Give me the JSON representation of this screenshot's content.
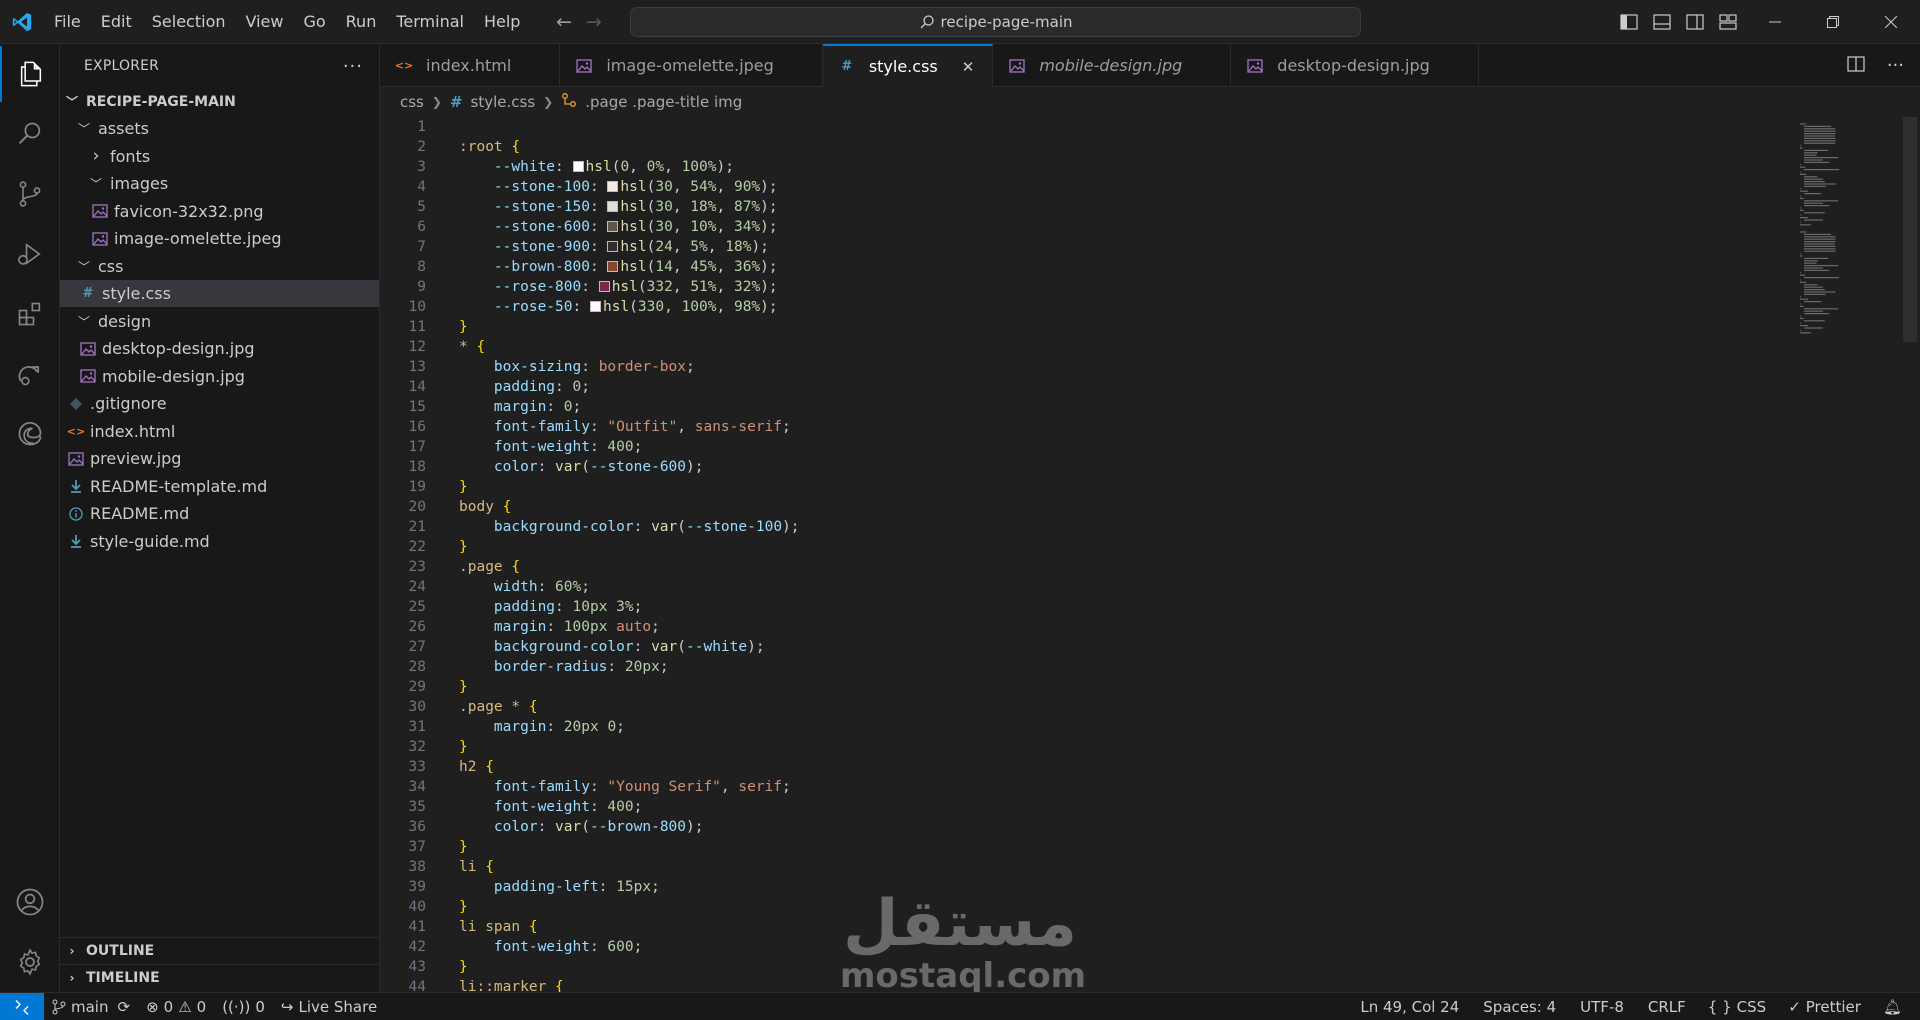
{
  "titlebar": {
    "menu": [
      "File",
      "Edit",
      "Selection",
      "View",
      "Go",
      "Run",
      "Terminal",
      "Help"
    ],
    "search": "recipe-page-main"
  },
  "sidebar": {
    "title": "EXPLORER",
    "root": "RECIPE-PAGE-MAIN",
    "tree": [
      {
        "label": "assets",
        "depth": 1,
        "kind": "folder-open"
      },
      {
        "label": "fonts",
        "depth": 2,
        "kind": "folder-closed"
      },
      {
        "label": "images",
        "depth": 2,
        "kind": "folder-open"
      },
      {
        "label": "favicon-32x32.png",
        "depth": 3,
        "kind": "image"
      },
      {
        "label": "image-omelette.jpeg",
        "depth": 3,
        "kind": "image"
      },
      {
        "label": "css",
        "depth": 1,
        "kind": "folder-open"
      },
      {
        "label": "style.css",
        "depth": 2,
        "kind": "css",
        "selected": true
      },
      {
        "label": "design",
        "depth": 1,
        "kind": "folder-open"
      },
      {
        "label": "desktop-design.jpg",
        "depth": 2,
        "kind": "image"
      },
      {
        "label": "mobile-design.jpg",
        "depth": 2,
        "kind": "image"
      },
      {
        "label": ".gitignore",
        "depth": 1,
        "kind": "git"
      },
      {
        "label": "index.html",
        "depth": 1,
        "kind": "html"
      },
      {
        "label": "preview.jpg",
        "depth": 1,
        "kind": "image"
      },
      {
        "label": "README-template.md",
        "depth": 1,
        "kind": "md"
      },
      {
        "label": "README.md",
        "depth": 1,
        "kind": "info"
      },
      {
        "label": "style-guide.md",
        "depth": 1,
        "kind": "md"
      }
    ],
    "outline": "OUTLINE",
    "timeline": "TIMELINE"
  },
  "tabs": [
    {
      "label": "index.html",
      "kind": "html",
      "active": false,
      "preview": false
    },
    {
      "label": "image-omelette.jpeg",
      "kind": "image",
      "active": false,
      "preview": false
    },
    {
      "label": "style.css",
      "kind": "css",
      "active": true,
      "preview": false
    },
    {
      "label": "mobile-design.jpg",
      "kind": "image",
      "active": false,
      "preview": true
    },
    {
      "label": "desktop-design.jpg",
      "kind": "image",
      "active": false,
      "preview": false
    }
  ],
  "breadcrumb": {
    "folder": "css",
    "file": "style.css",
    "symbol": ".page .page-title img"
  },
  "code": [
    [],
    [
      [
        "s-sel",
        ":root"
      ],
      [
        "s-pun",
        " "
      ],
      [
        "s-br",
        "{"
      ]
    ],
    [
      [
        "s-pun",
        "    "
      ],
      [
        "s-prop",
        "--white"
      ],
      [
        "s-pun",
        ": "
      ],
      [
        "sw",
        "#ffffff"
      ],
      [
        "s-fn",
        "hsl"
      ],
      [
        "s-pun",
        "("
      ],
      [
        "s-num",
        "0"
      ],
      [
        "s-pun",
        ", "
      ],
      [
        "s-num",
        "0%"
      ],
      [
        "s-pun",
        ", "
      ],
      [
        "s-num",
        "100%"
      ],
      [
        "s-pun",
        ");"
      ]
    ],
    [
      [
        "s-pun",
        "    "
      ],
      [
        "s-prop",
        "--stone-100"
      ],
      [
        "s-pun",
        ": "
      ],
      [
        "sw",
        "#f2e9e1"
      ],
      [
        "s-fn",
        "hsl"
      ],
      [
        "s-pun",
        "("
      ],
      [
        "s-num",
        "30"
      ],
      [
        "s-pun",
        ", "
      ],
      [
        "s-num",
        "54%"
      ],
      [
        "s-pun",
        ", "
      ],
      [
        "s-num",
        "90%"
      ],
      [
        "s-pun",
        ");"
      ]
    ],
    [
      [
        "s-pun",
        "    "
      ],
      [
        "s-prop",
        "--stone-150"
      ],
      [
        "s-pun",
        ": "
      ],
      [
        "sw",
        "#e3ddd7"
      ],
      [
        "s-fn",
        "hsl"
      ],
      [
        "s-pun",
        "("
      ],
      [
        "s-num",
        "30"
      ],
      [
        "s-pun",
        ", "
      ],
      [
        "s-num",
        "18%"
      ],
      [
        "s-pun",
        ", "
      ],
      [
        "s-num",
        "87%"
      ],
      [
        "s-pun",
        ");"
      ]
    ],
    [
      [
        "s-pun",
        "    "
      ],
      [
        "s-prop",
        "--stone-600"
      ],
      [
        "s-pun",
        ": "
      ],
      [
        "sw",
        "#5f564d"
      ],
      [
        "s-fn",
        "hsl"
      ],
      [
        "s-pun",
        "("
      ],
      [
        "s-num",
        "30"
      ],
      [
        "s-pun",
        ", "
      ],
      [
        "s-num",
        "10%"
      ],
      [
        "s-pun",
        ", "
      ],
      [
        "s-num",
        "34%"
      ],
      [
        "s-pun",
        ");"
      ]
    ],
    [
      [
        "s-pun",
        "    "
      ],
      [
        "s-prop",
        "--stone-900"
      ],
      [
        "s-pun",
        ": "
      ],
      [
        "sw",
        "#312e2c"
      ],
      [
        "s-fn",
        "hsl"
      ],
      [
        "s-pun",
        "("
      ],
      [
        "s-num",
        "24"
      ],
      [
        "s-pun",
        ", "
      ],
      [
        "s-num",
        "5%"
      ],
      [
        "s-pun",
        ", "
      ],
      [
        "s-num",
        "18%"
      ],
      [
        "s-pun",
        ");"
      ]
    ],
    [
      [
        "s-pun",
        "    "
      ],
      [
        "s-prop",
        "--brown-800"
      ],
      [
        "s-pun",
        ": "
      ],
      [
        "sw",
        "#854632"
      ],
      [
        "s-fn",
        "hsl"
      ],
      [
        "s-pun",
        "("
      ],
      [
        "s-num",
        "14"
      ],
      [
        "s-pun",
        ", "
      ],
      [
        "s-num",
        "45%"
      ],
      [
        "s-pun",
        ", "
      ],
      [
        "s-num",
        "36%"
      ],
      [
        "s-pun",
        ");"
      ]
    ],
    [
      [
        "s-pun",
        "    "
      ],
      [
        "s-prop",
        "--rose-800"
      ],
      [
        "s-pun",
        ": "
      ],
      [
        "sw",
        "#7a284e"
      ],
      [
        "s-fn",
        "hsl"
      ],
      [
        "s-pun",
        "("
      ],
      [
        "s-num",
        "332"
      ],
      [
        "s-pun",
        ", "
      ],
      [
        "s-num",
        "51%"
      ],
      [
        "s-pun",
        ", "
      ],
      [
        "s-num",
        "32%"
      ],
      [
        "s-pun",
        ");"
      ]
    ],
    [
      [
        "s-pun",
        "    "
      ],
      [
        "s-prop",
        "--rose-50"
      ],
      [
        "s-pun",
        ": "
      ],
      [
        "sw",
        "#fff7fb"
      ],
      [
        "s-fn",
        "hsl"
      ],
      [
        "s-pun",
        "("
      ],
      [
        "s-num",
        "330"
      ],
      [
        "s-pun",
        ", "
      ],
      [
        "s-num",
        "100%"
      ],
      [
        "s-pun",
        ", "
      ],
      [
        "s-num",
        "98%"
      ],
      [
        "s-pun",
        ");"
      ]
    ],
    [
      [
        "s-br",
        "}"
      ]
    ],
    [
      [
        "s-sel",
        "*"
      ],
      [
        "s-pun",
        " "
      ],
      [
        "s-br",
        "{"
      ]
    ],
    [
      [
        "s-pun",
        "    "
      ],
      [
        "s-prop",
        "box-sizing"
      ],
      [
        "s-pun",
        ": "
      ],
      [
        "s-val",
        "border-box"
      ],
      [
        "s-pun",
        ";"
      ]
    ],
    [
      [
        "s-pun",
        "    "
      ],
      [
        "s-prop",
        "padding"
      ],
      [
        "s-pun",
        ": "
      ],
      [
        "s-num",
        "0"
      ],
      [
        "s-pun",
        ";"
      ]
    ],
    [
      [
        "s-pun",
        "    "
      ],
      [
        "s-prop",
        "margin"
      ],
      [
        "s-pun",
        ": "
      ],
      [
        "s-num",
        "0"
      ],
      [
        "s-pun",
        ";"
      ]
    ],
    [
      [
        "s-pun",
        "    "
      ],
      [
        "s-prop",
        "font-family"
      ],
      [
        "s-pun",
        ": "
      ],
      [
        "s-val",
        "\"Outfit\""
      ],
      [
        "s-pun",
        ", "
      ],
      [
        "s-val",
        "sans-serif"
      ],
      [
        "s-pun",
        ";"
      ]
    ],
    [
      [
        "s-pun",
        "    "
      ],
      [
        "s-prop",
        "font-weight"
      ],
      [
        "s-pun",
        ": "
      ],
      [
        "s-num",
        "400"
      ],
      [
        "s-pun",
        ";"
      ]
    ],
    [
      [
        "s-pun",
        "    "
      ],
      [
        "s-prop",
        "color"
      ],
      [
        "s-pun",
        ": "
      ],
      [
        "s-fn",
        "var"
      ],
      [
        "s-pun",
        "("
      ],
      [
        "s-prop",
        "--stone-600"
      ],
      [
        "s-pun",
        ");"
      ]
    ],
    [
      [
        "s-br",
        "}"
      ]
    ],
    [
      [
        "s-sel",
        "body"
      ],
      [
        "s-pun",
        " "
      ],
      [
        "s-br",
        "{"
      ]
    ],
    [
      [
        "s-pun",
        "    "
      ],
      [
        "s-prop",
        "background-color"
      ],
      [
        "s-pun",
        ": "
      ],
      [
        "s-fn",
        "var"
      ],
      [
        "s-pun",
        "("
      ],
      [
        "s-prop",
        "--stone-100"
      ],
      [
        "s-pun",
        ");"
      ]
    ],
    [
      [
        "s-br",
        "}"
      ]
    ],
    [
      [
        "s-sel",
        ".page"
      ],
      [
        "s-pun",
        " "
      ],
      [
        "s-br",
        "{"
      ]
    ],
    [
      [
        "s-pun",
        "    "
      ],
      [
        "s-prop",
        "width"
      ],
      [
        "s-pun",
        ": "
      ],
      [
        "s-num",
        "60%"
      ],
      [
        "s-pun",
        ";"
      ]
    ],
    [
      [
        "s-pun",
        "    "
      ],
      [
        "s-prop",
        "padding"
      ],
      [
        "s-pun",
        ": "
      ],
      [
        "s-num",
        "10px"
      ],
      [
        "s-pun",
        " "
      ],
      [
        "s-num",
        "3%"
      ],
      [
        "s-pun",
        ";"
      ]
    ],
    [
      [
        "s-pun",
        "    "
      ],
      [
        "s-prop",
        "margin"
      ],
      [
        "s-pun",
        ": "
      ],
      [
        "s-num",
        "100px"
      ],
      [
        "s-pun",
        " "
      ],
      [
        "s-val",
        "auto"
      ],
      [
        "s-pun",
        ";"
      ]
    ],
    [
      [
        "s-pun",
        "    "
      ],
      [
        "s-prop",
        "background-color"
      ],
      [
        "s-pun",
        ": "
      ],
      [
        "s-fn",
        "var"
      ],
      [
        "s-pun",
        "("
      ],
      [
        "s-prop",
        "--white"
      ],
      [
        "s-pun",
        ");"
      ]
    ],
    [
      [
        "s-pun",
        "    "
      ],
      [
        "s-prop",
        "border-radius"
      ],
      [
        "s-pun",
        ": "
      ],
      [
        "s-num",
        "20px"
      ],
      [
        "s-pun",
        ";"
      ]
    ],
    [
      [
        "s-br",
        "}"
      ]
    ],
    [
      [
        "s-sel",
        ".page"
      ],
      [
        "s-pun",
        " "
      ],
      [
        "s-sel",
        "*"
      ],
      [
        "s-pun",
        " "
      ],
      [
        "s-br",
        "{"
      ]
    ],
    [
      [
        "s-pun",
        "    "
      ],
      [
        "s-prop",
        "margin"
      ],
      [
        "s-pun",
        ": "
      ],
      [
        "s-num",
        "20px"
      ],
      [
        "s-pun",
        " "
      ],
      [
        "s-num",
        "0"
      ],
      [
        "s-pun",
        ";"
      ]
    ],
    [
      [
        "s-br",
        "}"
      ]
    ],
    [
      [
        "s-sel",
        "h2"
      ],
      [
        "s-pun",
        " "
      ],
      [
        "s-br",
        "{"
      ]
    ],
    [
      [
        "s-pun",
        "    "
      ],
      [
        "s-prop",
        "font-family"
      ],
      [
        "s-pun",
        ": "
      ],
      [
        "s-val",
        "\"Young Serif\""
      ],
      [
        "s-pun",
        ", "
      ],
      [
        "s-val",
        "serif"
      ],
      [
        "s-pun",
        ";"
      ]
    ],
    [
      [
        "s-pun",
        "    "
      ],
      [
        "s-prop",
        "font-weight"
      ],
      [
        "s-pun",
        ": "
      ],
      [
        "s-num",
        "400"
      ],
      [
        "s-pun",
        ";"
      ]
    ],
    [
      [
        "s-pun",
        "    "
      ],
      [
        "s-prop",
        "color"
      ],
      [
        "s-pun",
        ": "
      ],
      [
        "s-fn",
        "var"
      ],
      [
        "s-pun",
        "("
      ],
      [
        "s-prop",
        "--brown-800"
      ],
      [
        "s-pun",
        ");"
      ]
    ],
    [
      [
        "s-br",
        "}"
      ]
    ],
    [
      [
        "s-sel",
        "li"
      ],
      [
        "s-pun",
        " "
      ],
      [
        "s-br",
        "{"
      ]
    ],
    [
      [
        "s-pun",
        "    "
      ],
      [
        "s-prop",
        "padding-left"
      ],
      [
        "s-pun",
        ": "
      ],
      [
        "s-num",
        "15px"
      ],
      [
        "s-pun",
        ";"
      ]
    ],
    [
      [
        "s-br",
        "}"
      ]
    ],
    [
      [
        "s-sel",
        "li span"
      ],
      [
        "s-pun",
        " "
      ],
      [
        "s-br",
        "{"
      ]
    ],
    [
      [
        "s-pun",
        "    "
      ],
      [
        "s-prop",
        "font-weight"
      ],
      [
        "s-pun",
        ": "
      ],
      [
        "s-num",
        "600"
      ],
      [
        "s-pun",
        ";"
      ]
    ],
    [
      [
        "s-br",
        "}"
      ]
    ],
    [
      [
        "s-sel",
        "li::marker"
      ],
      [
        "s-pun",
        " "
      ],
      [
        "s-br",
        "{"
      ]
    ]
  ],
  "watermark": {
    "arabic": "مستقل",
    "latin": "mostaql.com"
  },
  "statusbar": {
    "branch": "main",
    "errors": "0",
    "warnings": "0",
    "ports": "0",
    "live_share": "Live Share",
    "position": "Ln 49, Col 24",
    "spaces": "Spaces: 4",
    "encoding": "UTF-8",
    "eol": "CRLF",
    "language": "CSS",
    "formatter": "Prettier"
  },
  "colors": {
    "accent": "#0078d4",
    "css_icon": "#519aba",
    "html_icon": "#e37933",
    "image_icon": "#a074c4",
    "md_icon": "#519aba"
  }
}
